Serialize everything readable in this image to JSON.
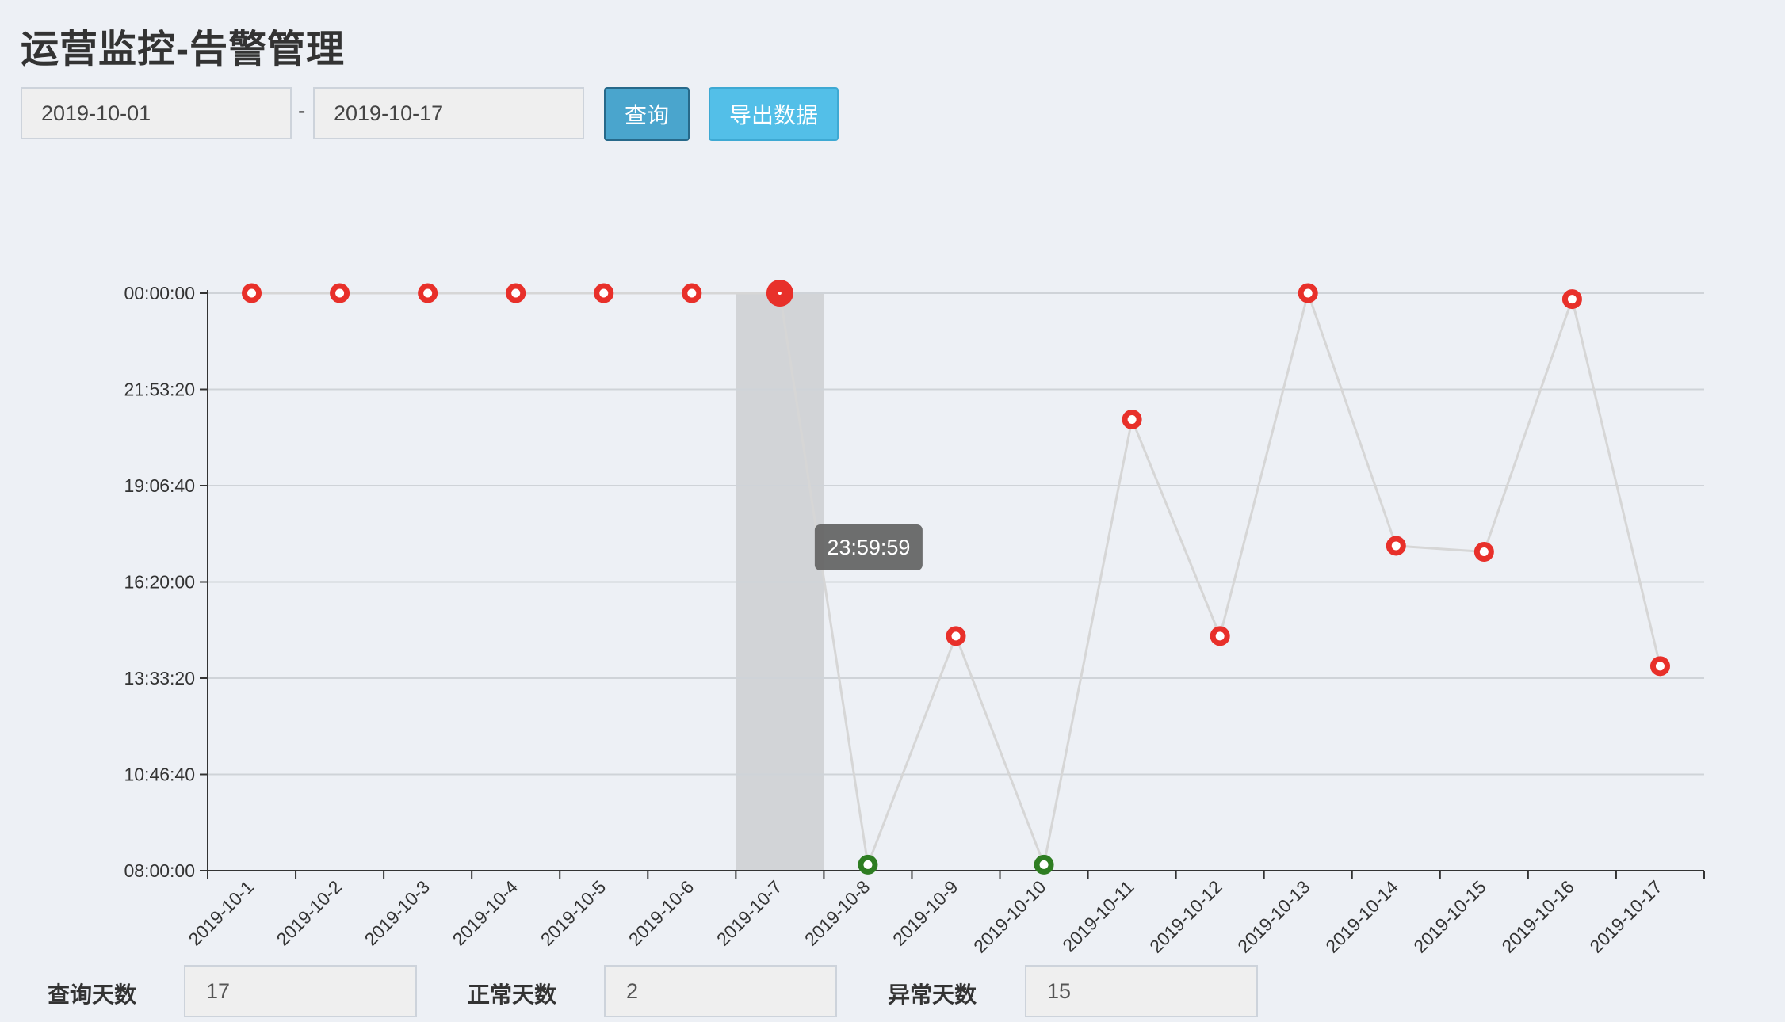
{
  "header": {
    "title": "运营监控-告警管理"
  },
  "filters": {
    "start_date": "2019-10-01",
    "separator": "-",
    "end_date": "2019-10-17",
    "query_label": "查询",
    "export_label": "导出数据"
  },
  "chart_data": {
    "type": "line",
    "x": [
      "2019-10-1",
      "2019-10-2",
      "2019-10-3",
      "2019-10-4",
      "2019-10-5",
      "2019-10-6",
      "2019-10-7",
      "2019-10-8",
      "2019-10-9",
      "2019-10-10",
      "2019-10-11",
      "2019-10-12",
      "2019-10-13",
      "2019-10-14",
      "2019-10-15",
      "2019-10-16",
      "2019-10-17"
    ],
    "series": [
      {
        "values": [
          "23:59:59",
          "23:59:59",
          "23:59:59",
          "23:59:59",
          "23:59:59",
          "23:59:59",
          "23:59:59",
          "08:10:00",
          "14:30:00",
          "08:10:00",
          "20:30:00",
          "14:30:00",
          "23:59:59",
          "17:00:00",
          "16:50:00",
          "23:50:00",
          "13:40:00"
        ],
        "status": [
          "abnormal",
          "abnormal",
          "abnormal",
          "abnormal",
          "abnormal",
          "abnormal",
          "abnormal",
          "normal",
          "abnormal",
          "normal",
          "abnormal",
          "abnormal",
          "abnormal",
          "abnormal",
          "abnormal",
          "abnormal",
          "abnormal"
        ]
      }
    ],
    "y_ticks": [
      "08:00:00",
      "10:46:40",
      "13:33:20",
      "16:20:00",
      "19:06:40",
      "21:53:20",
      "00:00:00"
    ],
    "ylim": [
      "08:00:00",
      "24:00:00"
    ],
    "grid": true,
    "highlighted_category": "2019-10-7",
    "tooltip": "23:59:59",
    "colors": {
      "abnormal": "#e8302a",
      "normal": "#2e7d22",
      "line": "#d6d6d6",
      "grid": "#cfd3d8",
      "highlight": "#d2d4d7"
    }
  },
  "stats": {
    "query_days_label": "查询天数",
    "query_days": "17",
    "normal_days_label": "正常天数",
    "normal_days": "2",
    "abnormal_days_label": "异常天数",
    "abnormal_days": "15"
  }
}
